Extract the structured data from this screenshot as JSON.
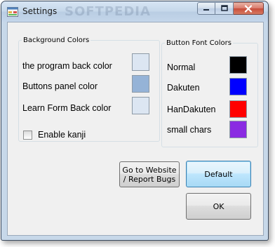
{
  "window": {
    "title": "Settings",
    "watermark": "SOFTPEDIA",
    "icon": "app-window-icon"
  },
  "caption_buttons": {
    "minimize_icon": "minimize-icon",
    "maximize_icon": "maximize-icon",
    "close_icon": "close-icon"
  },
  "background_colors": {
    "legend": "Background Colors",
    "items": [
      {
        "label": "the program back color",
        "color": "#dce6f2"
      },
      {
        "label": "Buttons panel color",
        "color": "#95b3d7"
      },
      {
        "label": "Learn Form Back color",
        "color": "#dce6f2"
      }
    ]
  },
  "button_font_colors": {
    "legend": "Button Font Colors",
    "items": [
      {
        "label": "Normal",
        "color": "#000000"
      },
      {
        "label": "Dakuten",
        "color": "#0000ff"
      },
      {
        "label": "HanDakuten",
        "color": "#ff0000"
      },
      {
        "label": "small chars",
        "color": "#8a2be2"
      }
    ]
  },
  "options": {
    "enable_kanji_label": "Enable kanji",
    "enable_kanji_checked": false
  },
  "buttons": {
    "website_line1": "Go to Website",
    "website_line2": "/ Report Bugs",
    "default_label": "Default",
    "ok_label": "OK"
  }
}
